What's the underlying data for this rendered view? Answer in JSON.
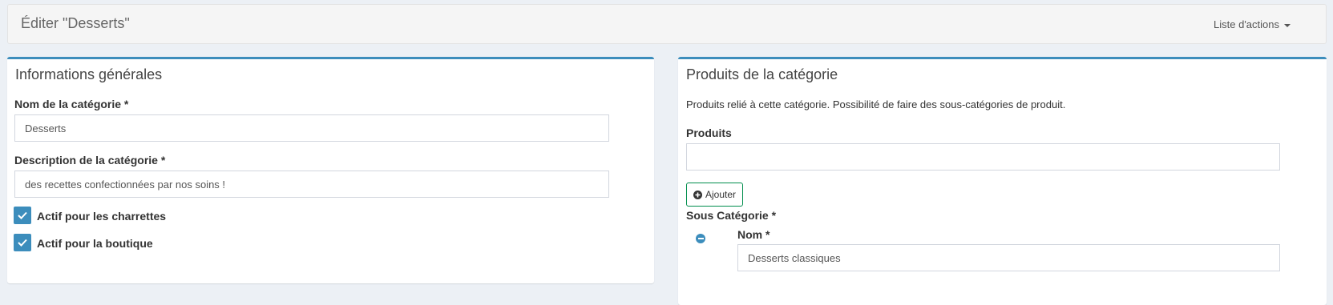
{
  "header": {
    "title": "Éditer \"Desserts\"",
    "actions_label": "Liste d'actions"
  },
  "general": {
    "title": "Informations générales",
    "name_label": "Nom de la catégorie *",
    "name_value": "Desserts",
    "description_label": "Description de la catégorie *",
    "description_value": "des recettes confectionnées par nos soins !",
    "checkboxes": [
      {
        "label": "Actif pour les charrettes",
        "checked": true
      },
      {
        "label": "Actif pour la boutique",
        "checked": true
      }
    ]
  },
  "products": {
    "title": "Produits de la catégorie",
    "description": "Produits relié à cette catégorie. Possibilité de faire des sous-catégories de produit.",
    "products_label": "Produits",
    "products_value": "",
    "add_button_label": "Ajouter",
    "subcategory_label": "Sous Catégorie *",
    "subcategory_name_label": "Nom *",
    "subcategory_name_value": "Desserts classiques"
  },
  "colors": {
    "accent": "#3c8dbc",
    "success_border": "#008d4c",
    "background": "#ecf0f5"
  },
  "icons": [
    "caret-down-icon",
    "check-icon",
    "plus-circle-icon",
    "minus-circle-icon"
  ]
}
